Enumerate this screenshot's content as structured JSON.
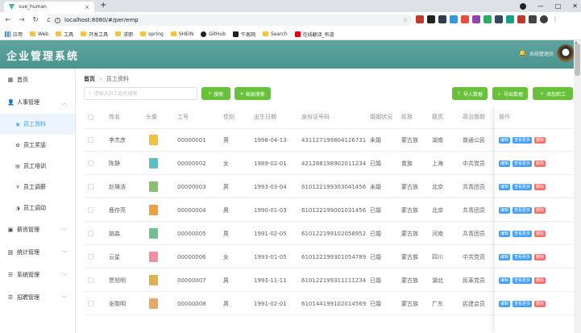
{
  "browser": {
    "tab_title": "vue_human",
    "url": "localhost:8080/#/per/emp",
    "bookmarks": [
      "应用",
      "Web",
      "工具",
      "开发工具",
      "求职",
      "spring",
      "SHEIN",
      "GitHub",
      "牛客网",
      "Search",
      "在线翻译_有道"
    ]
  },
  "header": {
    "logo": "企业管理系统",
    "user": "系统管理员"
  },
  "sidebar": {
    "home": "首页",
    "groups": [
      {
        "label": "人事管理",
        "icon": "user-icon"
      },
      {
        "label": "薪资管理",
        "icon": "money-icon"
      },
      {
        "label": "统计管理",
        "icon": "chart-icon"
      },
      {
        "label": "系统管理",
        "icon": "menu-icon"
      },
      {
        "label": "招聘管理",
        "icon": "list-icon"
      }
    ],
    "subs": [
      {
        "label": "员工资料",
        "icon": "user-icon"
      },
      {
        "label": "员工奖惩",
        "icon": "gift-icon"
      },
      {
        "label": "员工培训",
        "icon": "doc-icon"
      },
      {
        "label": "员工调薪",
        "icon": "yen-icon"
      },
      {
        "label": "员工调动",
        "icon": "swap-icon"
      }
    ]
  },
  "breadcrumb": {
    "home": "首页",
    "current": "员工资料"
  },
  "search": {
    "placeholder": "请输入员工姓名搜索"
  },
  "buttons": {
    "search": "搜索",
    "advanced": "高级搜索",
    "import": "导入数据",
    "export": "导出数据",
    "add": "添加职工"
  },
  "table": {
    "headers": [
      "姓名",
      "头像",
      "工号",
      "性别",
      "出生日期",
      "身份证号码",
      "婚姻状况",
      "民族",
      "籍贯",
      "政治面貌",
      "操作"
    ],
    "ops": {
      "edit": "编辑",
      "more": "查看更多",
      "delete": "删除"
    },
    "rows": [
      {
        "name": "李杰彦",
        "id": "00000001",
        "gender": "男",
        "birth": "1998-04-13",
        "idcard": "431127199804126731",
        "marital": "未婚",
        "nation": "蒙古族",
        "origin": "湖南",
        "political": "普通公民",
        "avatar_color": "#f0c040"
      },
      {
        "name": "陈静",
        "id": "00000002",
        "gender": "女",
        "birth": "1989-02-01",
        "idcard": "421288198902011234",
        "marital": "已婚",
        "nation": "苗族",
        "origin": "上海",
        "political": "中共党员",
        "avatar_color": "#5bc0c0"
      },
      {
        "name": "赵琳浩",
        "id": "00000003",
        "gender": "男",
        "birth": "1993-03-04",
        "idcard": "610122199303041456",
        "marital": "未婚",
        "nation": "蒙古族",
        "origin": "北京",
        "political": "共青团员",
        "avatar_color": "#88c070"
      },
      {
        "name": "鹿存亮",
        "id": "00000004",
        "gender": "男",
        "birth": "1990-01-03",
        "idcard": "610122199001031456",
        "marital": "已婚",
        "nation": "蒙古族",
        "origin": "北京",
        "political": "共青团员",
        "avatar_color": "#f0a040"
      },
      {
        "name": "姚森",
        "id": "00000005",
        "gender": "男",
        "birth": "1991-02-05",
        "idcard": "610122199102058952",
        "marital": "已婚",
        "nation": "蒙古族",
        "origin": "河南",
        "political": "共青团员",
        "avatar_color": "#70c090"
      },
      {
        "name": "云星",
        "id": "00000006",
        "gender": "女",
        "birth": "1993-01-05",
        "idcard": "610122199301054789",
        "marital": "已婚",
        "nation": "蒙古族",
        "origin": "四川",
        "political": "中共党员",
        "avatar_color": "#f090a0"
      },
      {
        "name": "贾旭明",
        "id": "00000007",
        "gender": "男",
        "birth": "1993-11-11",
        "idcard": "610122199311111234",
        "marital": "已婚",
        "nation": "蒙古族",
        "origin": "湖北",
        "political": "民革党员",
        "avatar_color": "#e0b050"
      },
      {
        "name": "张黎明",
        "id": "00000008",
        "gender": "男",
        "birth": "1991-02-01",
        "idcard": "610144199102014569",
        "marital": "已婚",
        "nation": "蒙古族",
        "origin": "广东",
        "political": "民建会员",
        "avatar_color": "#e8a868"
      }
    ]
  },
  "colors": {
    "primary": "#409eff",
    "success": "#67c23a",
    "danger": "#f56c6c",
    "header": "#4a958f"
  }
}
